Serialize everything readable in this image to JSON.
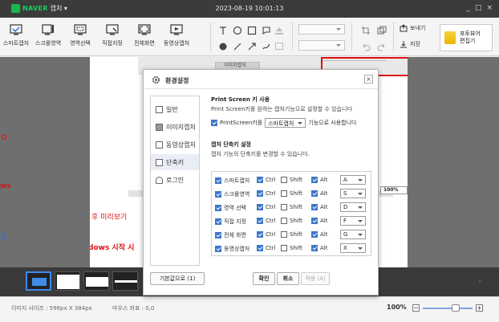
{
  "titlebar": {
    "brand": "NAVER",
    "app_name": "캡처 ▾",
    "timestamp": "2023-08-19 10:01:13",
    "controls": [
      "_",
      "□",
      "×"
    ]
  },
  "toolbar": {
    "tools": [
      {
        "label": "스마트캡처",
        "icon": "smart-capture-icon"
      },
      {
        "label": "스크롤영역",
        "icon": "scroll-area-icon"
      },
      {
        "label": "영역선택",
        "icon": "area-select-icon"
      },
      {
        "label": "직접지정",
        "icon": "direct-specify-icon"
      },
      {
        "label": "전체화면",
        "icon": "fullscreen-icon"
      },
      {
        "label": "동영상캡처",
        "icon": "video-capture-icon"
      }
    ],
    "share": "보내기",
    "save": "저장",
    "photo_editor": "포토뷰어\n편집기"
  },
  "background_text": {
    "line1": "D",
    "line2": "ws",
    "line3": "후 미리보기 ",
    "line4": "dows 시작 시",
    "tab_label": "이미지캡처",
    "zoom_chip": "100%"
  },
  "dialog": {
    "title": "환경설정",
    "close": "×",
    "sidebar": [
      {
        "label": "일반",
        "selected": false
      },
      {
        "label": "이미지캡처",
        "selected": false
      },
      {
        "label": "동영상캡처",
        "selected": false
      },
      {
        "label": "단축키",
        "selected": true
      },
      {
        "label": "로그인",
        "selected": false
      }
    ],
    "printscreen": {
      "title": "Print Screen 키 사용",
      "desc": "Print Screen키를 원하는 캡처기능으로 설정할 수 있습니다",
      "checkbox_label": "PrintScreen키를",
      "dropdown_value": "스마트캡처",
      "suffix": "기능으로 사용합니다"
    },
    "shortcuts": {
      "title": "캡처 단축키 설정",
      "desc": "캡처 기능의 단축키를 변경할 수 있습니다.",
      "rows": [
        {
          "name": "스마트캡처",
          "ctrl": true,
          "shift": false,
          "alt": true,
          "key": "A"
        },
        {
          "name": "스크롤영역",
          "ctrl": true,
          "shift": false,
          "alt": true,
          "key": "S"
        },
        {
          "name": "영역 선택",
          "ctrl": true,
          "shift": false,
          "alt": true,
          "key": "D"
        },
        {
          "name": "직접 지정",
          "ctrl": true,
          "shift": false,
          "alt": true,
          "key": "F"
        },
        {
          "name": "전체 화면",
          "ctrl": true,
          "shift": false,
          "alt": true,
          "key": "G"
        },
        {
          "name": "동영상캡처",
          "ctrl": true,
          "shift": false,
          "alt": true,
          "key": "X"
        }
      ],
      "ctrl_label": "Ctrl",
      "shift_label": "Shift",
      "alt_label": "Alt"
    },
    "buttons": {
      "defaults": "기본값으로 (1)",
      "ok": "확인",
      "cancel": "취소",
      "apply": "적용 (A)"
    }
  },
  "statusbar": {
    "image_size": "이미지 사이즈 : 596px X 384px",
    "mouse_coord": "마우스 좌표 : 0,0",
    "zoom": "100%",
    "minus": "−",
    "plus": "+"
  },
  "colors": {
    "titlebar": "#3b3b3b",
    "naver_green": "#19ce60",
    "accent_blue": "#3c77c8",
    "red_highlight": "#e01010"
  }
}
